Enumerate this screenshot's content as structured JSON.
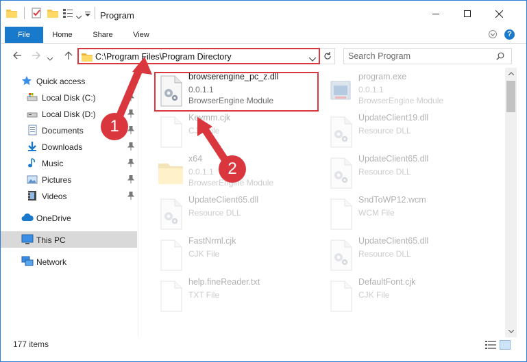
{
  "window": {
    "title": "Program",
    "minimize_label": "Minimize",
    "maximize_label": "Maximize",
    "close_label": "Close"
  },
  "ribbon": {
    "tabs": [
      "File",
      "Home",
      "Share",
      "View"
    ],
    "help": "?"
  },
  "nav": {
    "address": "C:\\Program Files\\Program Directory",
    "search_placeholder": "Search Program"
  },
  "sidebar": {
    "items": [
      {
        "label": "Quick access",
        "icon": "star-icon"
      },
      {
        "label": "Local Disk (C:)",
        "icon": "drive-icon",
        "pinned": true
      },
      {
        "label": "Local Disk (D:)",
        "icon": "drive-icon",
        "pinned": true
      },
      {
        "label": "Documents",
        "icon": "documents-icon",
        "pinned": true
      },
      {
        "label": "Downloads",
        "icon": "downloads-icon",
        "pinned": true
      },
      {
        "label": "Music",
        "icon": "music-icon",
        "pinned": true
      },
      {
        "label": "Pictures",
        "icon": "pictures-icon",
        "pinned": true
      },
      {
        "label": "Videos",
        "icon": "videos-icon",
        "pinned": true
      },
      {
        "label": "OneDrive",
        "icon": "cloud-icon"
      },
      {
        "label": "This PC",
        "icon": "computer-icon",
        "selected": true
      },
      {
        "label": "Network",
        "icon": "network-icon"
      }
    ]
  },
  "files": [
    {
      "name": "browserengine_pc_z.dll",
      "line1": "0.0.1.1",
      "line2": "BrowserEngine Module",
      "icon": "dll-gear-icon"
    },
    {
      "name": "program.exe",
      "line1": "0.0.1.1",
      "line2": "BrowserEngine Module",
      "icon": "exe-icon"
    },
    {
      "name": "Keymm.cjk",
      "line1": "CJK File",
      "line2": "",
      "icon": "blank-file-icon"
    },
    {
      "name": "UpdateClient19.dll",
      "line1": "Resource DLL",
      "line2": "",
      "icon": "dll-gear-icon"
    },
    {
      "name": "x64",
      "line1": "0.0.1.1",
      "line2": "BrowserEngine Module",
      "icon": "folder-icon"
    },
    {
      "name": "UpdateClient65.dll",
      "line1": "Resource DLL",
      "line2": "",
      "icon": "dll-gear-icon"
    },
    {
      "name": "UpdateClient65.dll",
      "line1": "Resource DLL",
      "line2": "",
      "icon": "dll-gear-icon"
    },
    {
      "name": "SndToWP12.wcm",
      "line1": "WCM File",
      "line2": "",
      "icon": "blank-file-icon"
    },
    {
      "name": "FastNrml.cjk",
      "line1": "CJK File",
      "line2": "",
      "icon": "blank-file-icon"
    },
    {
      "name": "UpdateClient65.dll",
      "line1": "Resource DLL",
      "line2": "",
      "icon": "dll-gear-icon"
    },
    {
      "name": "help.fineReader.txt",
      "line1": "TXT File",
      "line2": "",
      "icon": "blank-file-icon"
    },
    {
      "name": "DefaultFont.cjk",
      "line1": "CJK File",
      "line2": "",
      "icon": "blank-file-icon"
    }
  ],
  "status": {
    "item_count": "177 items"
  },
  "annotations": {
    "badge1": "1",
    "badge2": "2",
    "color": "#d9363e"
  },
  "colors": {
    "accent": "#1979ca",
    "selection": "#d9d9d9",
    "highlight": "#d9363e"
  }
}
